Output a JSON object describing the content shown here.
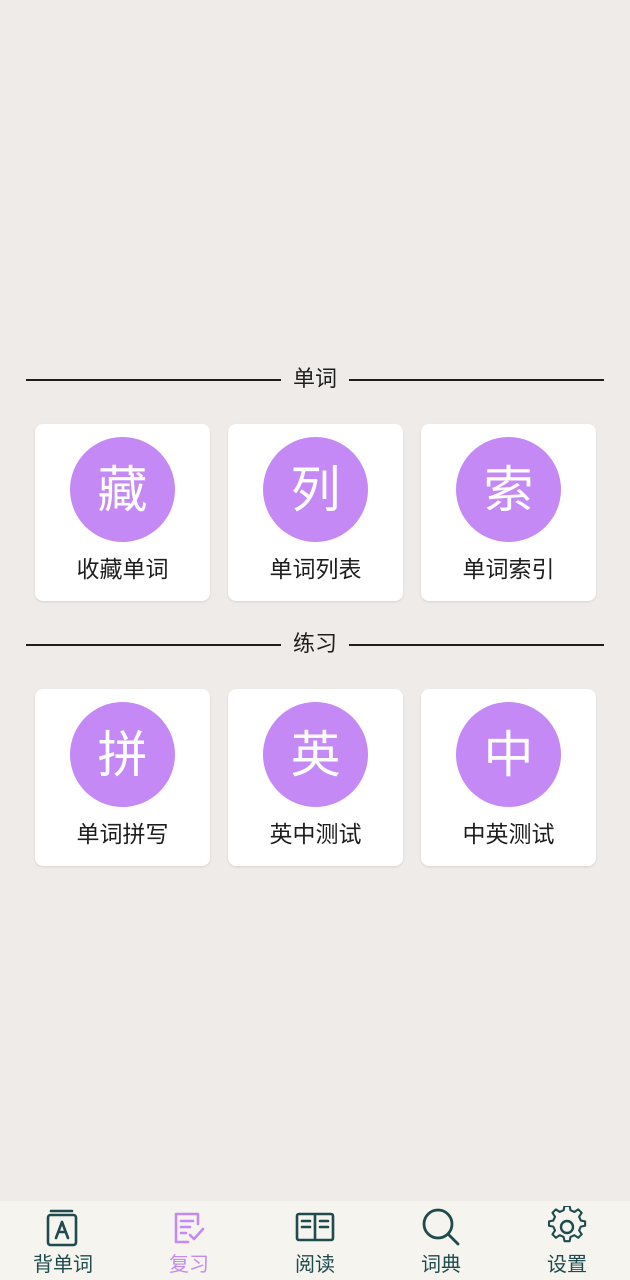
{
  "colors": {
    "background": "#eeebe8",
    "card": "#ffffff",
    "accent": "#c489f5",
    "nav_icon": "#1f4a4e",
    "nav_background": "#f5f4ee"
  },
  "sections": [
    {
      "title": "单词",
      "items": [
        {
          "glyph": "藏",
          "label": "收藏单词"
        },
        {
          "glyph": "列",
          "label": "单词列表"
        },
        {
          "glyph": "索",
          "label": "单词索引"
        }
      ]
    },
    {
      "title": "练习",
      "items": [
        {
          "glyph": "拼",
          "label": "单词拼写"
        },
        {
          "glyph": "英",
          "label": "英中测试"
        },
        {
          "glyph": "中",
          "label": "中英测试"
        }
      ]
    }
  ],
  "bottom_nav": {
    "active_index": 1,
    "items": [
      {
        "label": "背单词",
        "icon": "flashcard-book-icon"
      },
      {
        "label": "复习",
        "icon": "review-document-icon"
      },
      {
        "label": "阅读",
        "icon": "open-book-icon"
      },
      {
        "label": "词典",
        "icon": "search-icon"
      },
      {
        "label": "设置",
        "icon": "gear-icon"
      }
    ]
  }
}
